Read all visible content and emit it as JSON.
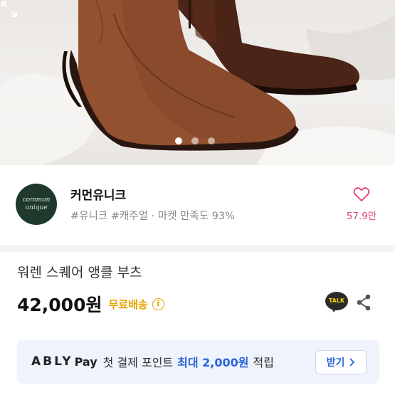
{
  "product_image": {
    "carousel_dots": 3,
    "active_index": 0
  },
  "shop": {
    "logo_line1": "common",
    "logo_line2": "unique",
    "name": "커먼유니크",
    "tags": "#유니크 #캐주얼 · 마켓 만족도 93%",
    "likes": "57.9만"
  },
  "product": {
    "title": "워렌 스퀘어 앵클 부츠",
    "price": "42,000원",
    "shipping": "무료배송",
    "info_symbol": "i"
  },
  "actions": {
    "kakao_label": "TALK"
  },
  "promo": {
    "brand": "ABLY",
    "pay": "Pay",
    "text": "첫 결제 포인트",
    "highlight": "최대 2,000원",
    "text_end": "적립",
    "button_label": "받기",
    "accent_color": "#2b63d9"
  },
  "colors": {
    "like": "#e0436b",
    "shipping": "#e8a400"
  }
}
